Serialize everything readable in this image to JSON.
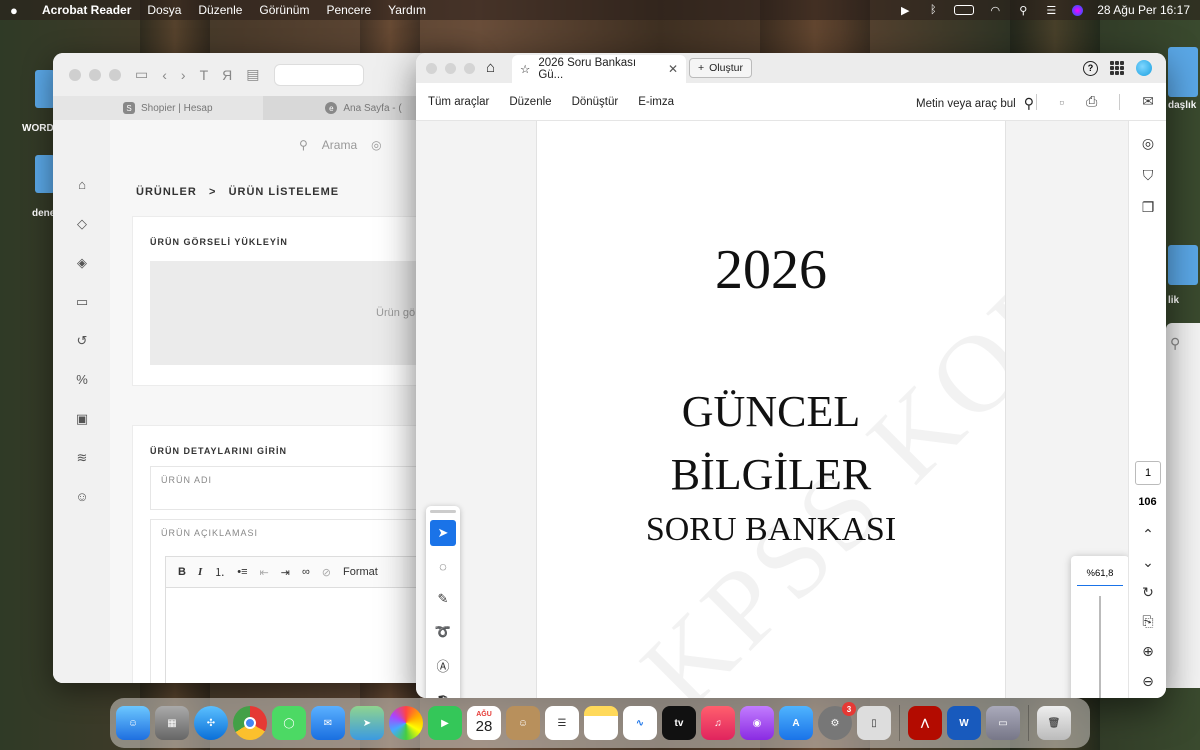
{
  "menubar": {
    "app_name": "Acrobat Reader",
    "items": [
      "Dosya",
      "Düzenle",
      "Görünüm",
      "Pencere",
      "Yardım"
    ],
    "datetime": "28 Ağu Per  16:17"
  },
  "desktop": {
    "label_word": "WORD",
    "label_deneme": "dene",
    "label_dasik": "daşlık",
    "label_lik": "lik"
  },
  "browser": {
    "tab1": "Shopier | Hesap",
    "tab2": "Ana Sayfa - (",
    "search_placeholder": "Arama",
    "breadcrumb_parent": "ÜRÜNLER",
    "breadcrumb_sep": ">",
    "breadcrumb_current": "ÜRÜN LİSTELEME",
    "upload_title": "ÜRÜN GÖRSELİ YÜKLEYİN",
    "upload_text": "Ürün gö",
    "details_title": "ÜRÜN DETAYLARINI GİRİN",
    "name_label": "ÜRÜN ADI",
    "desc_label": "ÜRÜN AÇIKLAMASI",
    "format_label": "Format"
  },
  "acrobat": {
    "tab_title": "2026 Soru Bankası Gü...",
    "create_label": "Oluştur",
    "menu": [
      "Tüm araçlar",
      "Düzenle",
      "Dönüştür",
      "E-imza"
    ],
    "find_label": "Metin veya araç bul",
    "page_current": "1",
    "page_total": "106",
    "zoom": "%61,8",
    "zoom_level_fraction": 0.82
  },
  "pdf": {
    "year": "2026",
    "line1": "GÜNCEL",
    "line2": "BİLGİLER",
    "line3": "SORU BANKASI",
    "watermark": "KPSS KOD"
  },
  "dock": {
    "calendar_month": "AĞU",
    "calendar_day": "28",
    "settings_badge": "3",
    "tv_label": "tv"
  }
}
